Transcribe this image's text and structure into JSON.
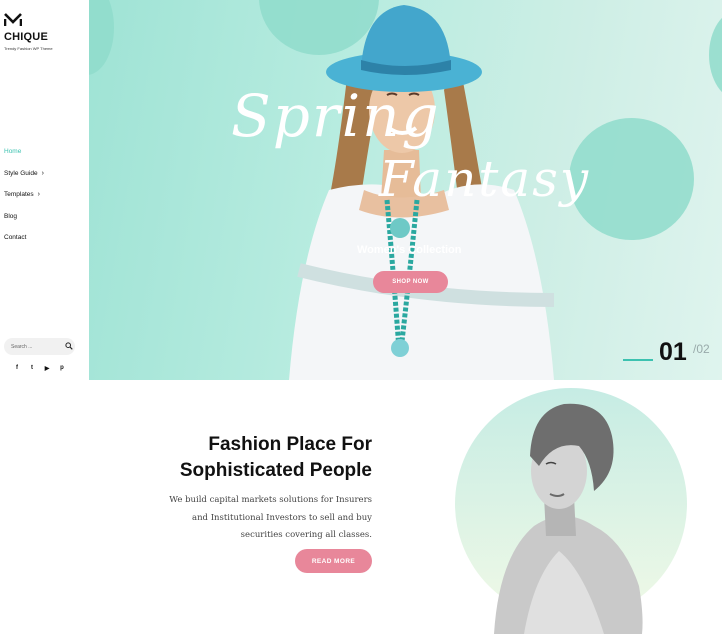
{
  "brand": {
    "name": "CHIQUE",
    "tagline": "Trendy Fashion WP Theme",
    "logo_icon": "m-chevron-logo"
  },
  "nav": {
    "items": [
      {
        "label": "Home",
        "active": true,
        "has_submenu": false
      },
      {
        "label": "Style Guide",
        "active": false,
        "has_submenu": true
      },
      {
        "label": "Templates",
        "active": false,
        "has_submenu": true
      },
      {
        "label": "Blog",
        "active": false,
        "has_submenu": false
      },
      {
        "label": "Contact",
        "active": false,
        "has_submenu": false
      }
    ],
    "chevron": "›"
  },
  "search": {
    "placeholder": "Search ...",
    "icon": "search-icon"
  },
  "social": {
    "facebook": "f",
    "twitter": "t",
    "youtube": "▶",
    "pinterest": "p"
  },
  "hero": {
    "title_line1": "Spring",
    "title_line2": "Fantasy",
    "subtitle": "Women's Collection",
    "button_label": "SHOP NOW",
    "slide_current": "01",
    "slide_total": "/02"
  },
  "intro": {
    "heading_line1": "Fashion Place For",
    "heading_line2": "Sophisticated People",
    "description_line1": "We build capital markets solutions for Insurers",
    "description_line2": "and Institutional Investors to sell and buy",
    "description_line3": "securities covering all classes.",
    "button_label": "READ MORE"
  },
  "colors": {
    "accent_teal": "#3cc2b0",
    "button_pink": "#e8879a",
    "hero_bg": "#b8ece0"
  }
}
